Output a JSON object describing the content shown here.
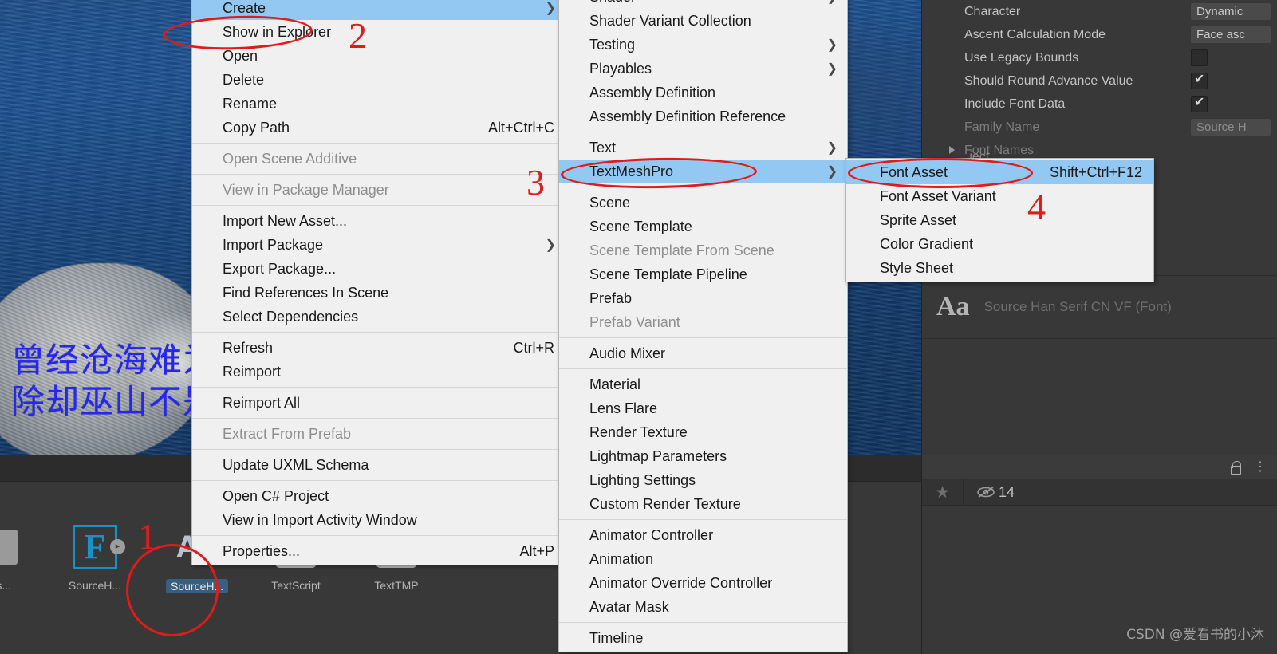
{
  "scene": {
    "text_line1": "曾经沧海难为水",
    "text_line2": "除却巫山不是云"
  },
  "project_panel": {
    "assets": [
      {
        "label": "tMes...",
        "icon": "folder-icon",
        "selected": false
      },
      {
        "label": "SourceH...",
        "icon": "font-file-icon",
        "selected": false
      },
      {
        "label": "SourceH...",
        "icon": "font-asset-icon",
        "selected": true
      },
      {
        "label": "TextScript",
        "icon": "tmp-script-icon",
        "selected": false
      },
      {
        "label": "TextTMP",
        "icon": "tmp-script-icon",
        "selected": false
      }
    ]
  },
  "menus": {
    "asset_context": {
      "items": [
        {
          "label": "Create",
          "selected": true,
          "submenu": true
        },
        {
          "label": "Show in Explorer"
        },
        {
          "label": "Open"
        },
        {
          "label": "Delete"
        },
        {
          "label": "Rename"
        },
        {
          "label": "Copy Path",
          "shortcut": "Alt+Ctrl+C"
        },
        {
          "divider": true
        },
        {
          "label": "Open Scene Additive",
          "disabled": true
        },
        {
          "divider": true
        },
        {
          "label": "View in Package Manager",
          "disabled": true
        },
        {
          "divider": true
        },
        {
          "label": "Import New Asset..."
        },
        {
          "label": "Import Package",
          "submenu": true
        },
        {
          "label": "Export Package..."
        },
        {
          "label": "Find References In Scene"
        },
        {
          "label": "Select Dependencies"
        },
        {
          "divider": true
        },
        {
          "label": "Refresh",
          "shortcut": "Ctrl+R"
        },
        {
          "label": "Reimport"
        },
        {
          "divider": true
        },
        {
          "label": "Reimport All"
        },
        {
          "divider": true
        },
        {
          "label": "Extract From Prefab",
          "disabled": true
        },
        {
          "divider": true
        },
        {
          "label": "Update UXML Schema"
        },
        {
          "divider": true
        },
        {
          "label": "Open C# Project"
        },
        {
          "label": "View in Import Activity Window"
        },
        {
          "divider": true
        },
        {
          "label": "Properties...",
          "shortcut": "Alt+P"
        }
      ]
    },
    "create_submenu": {
      "items": [
        {
          "label": "Shader",
          "submenu": true
        },
        {
          "label": "Shader Variant Collection"
        },
        {
          "label": "Testing",
          "submenu": true
        },
        {
          "label": "Playables",
          "submenu": true
        },
        {
          "label": "Assembly Definition"
        },
        {
          "label": "Assembly Definition Reference"
        },
        {
          "divider": true
        },
        {
          "label": "Text",
          "submenu": true
        },
        {
          "label": "TextMeshPro",
          "selected": true,
          "submenu": true
        },
        {
          "divider": true
        },
        {
          "label": "Scene"
        },
        {
          "label": "Scene Template"
        },
        {
          "label": "Scene Template From Scene",
          "disabled": true
        },
        {
          "label": "Scene Template Pipeline"
        },
        {
          "label": "Prefab"
        },
        {
          "label": "Prefab Variant",
          "disabled": true
        },
        {
          "divider": true
        },
        {
          "label": "Audio Mixer"
        },
        {
          "divider": true
        },
        {
          "label": "Material"
        },
        {
          "label": "Lens Flare"
        },
        {
          "label": "Render Texture"
        },
        {
          "label": "Lightmap Parameters"
        },
        {
          "label": "Lighting Settings"
        },
        {
          "label": "Custom Render Texture"
        },
        {
          "divider": true
        },
        {
          "label": "Animator Controller"
        },
        {
          "label": "Animation"
        },
        {
          "label": "Animator Override Controller"
        },
        {
          "label": "Avatar Mask"
        },
        {
          "divider": true
        },
        {
          "label": "Timeline"
        }
      ]
    },
    "textmeshpro_submenu": {
      "items": [
        {
          "label": "Font Asset",
          "selected": true,
          "shortcut": "Shift+Ctrl+F12"
        },
        {
          "label": "Font Asset Variant"
        },
        {
          "label": "Sprite Asset"
        },
        {
          "label": "Color Gradient"
        },
        {
          "label": "Style Sheet"
        }
      ]
    }
  },
  "inspector": {
    "rows": [
      {
        "label": "Character",
        "value": "Dynamic",
        "type": "dropdown",
        "clipped": true
      },
      {
        "label": "Ascent Calculation Mode",
        "value": "Face asc",
        "type": "dropdown",
        "clipped": true
      },
      {
        "label": "Use Legacy Bounds",
        "type": "checkbox",
        "checked": false
      },
      {
        "label": "Should Round Advance Value",
        "type": "checkbox",
        "checked": true
      },
      {
        "label": "Include Font Data",
        "type": "checkbox",
        "checked": true
      },
      {
        "label": "Family Name",
        "value": "Source H",
        "type": "text",
        "dim": true,
        "clipped": true
      },
      {
        "label": "Font Names",
        "type": "foldout"
      }
    ],
    "note": "...ject",
    "font_preview": {
      "glyph_label": "Aa",
      "name": "Source Han Serif CN VF  (Font)"
    },
    "toolbar": {
      "lock_icon": "unlock-icon",
      "menu_icon": "kebab-menu-icon"
    },
    "statusbar": {
      "star_icon": "star-icon",
      "eye_icon": "eye-slash-icon",
      "count": "14"
    }
  },
  "annotations": {
    "numbers": [
      "1",
      "2",
      "3",
      "4"
    ]
  },
  "watermark": "CSDN @爱看书的小沐",
  "colors": {
    "menu_highlight": "#92c8f2",
    "annotation_red": "#e01b1b",
    "panel_bg": "#383838",
    "scene_text_blue": "#2626f0"
  }
}
